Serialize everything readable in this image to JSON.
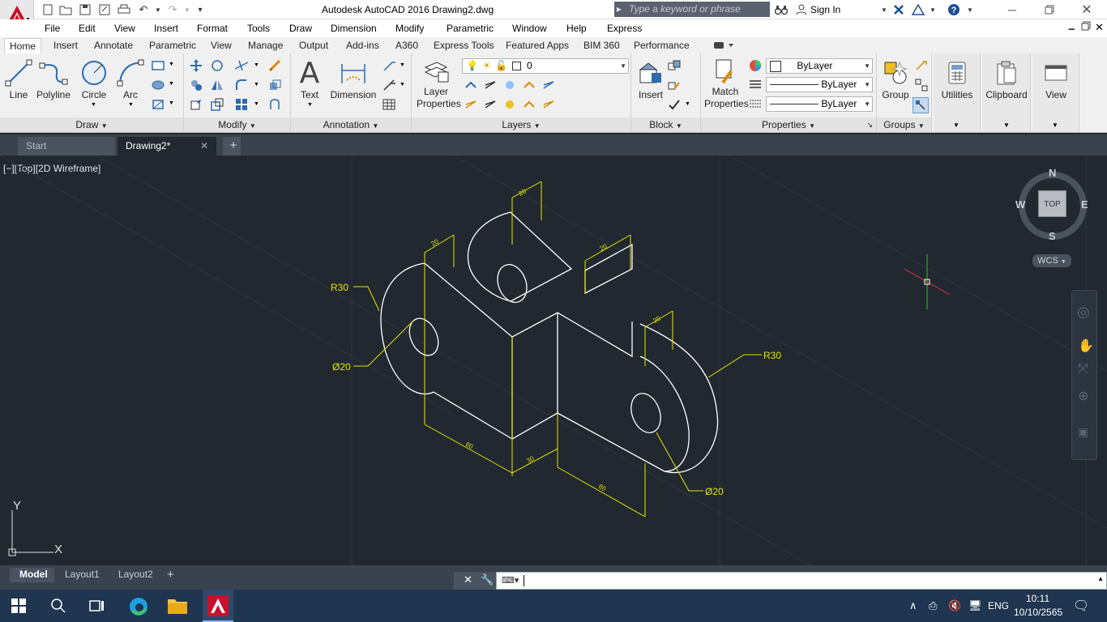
{
  "window": {
    "title": "Autodesk AutoCAD 2016   Drawing2.dwg",
    "app_logo": "A",
    "search_placeholder": "Type a keyword or phrase",
    "sign_in": "Sign In"
  },
  "menus": [
    "File",
    "Edit",
    "View",
    "Insert",
    "Format",
    "Tools",
    "Draw",
    "Dimension",
    "Modify",
    "Parametric",
    "Window",
    "Help",
    "Express"
  ],
  "ribbon_tabs": [
    "Home",
    "Insert",
    "Annotate",
    "Parametric",
    "View",
    "Manage",
    "Output",
    "Add-ins",
    "A360",
    "Express Tools",
    "Featured Apps",
    "BIM 360",
    "Performance"
  ],
  "ribbon": {
    "draw": {
      "title": "Draw",
      "line": "Line",
      "polyline": "Polyline",
      "circle": "Circle",
      "arc": "Arc"
    },
    "modify": {
      "title": "Modify"
    },
    "annotation": {
      "title": "Annotation",
      "text": "Text",
      "dimension": "Dimension"
    },
    "layers": {
      "title": "Layers",
      "properties_1": "Layer",
      "properties_2": "Properties",
      "current_layer": "0"
    },
    "block": {
      "title": "Block",
      "insert": "Insert"
    },
    "properties": {
      "title": "Properties",
      "match_1": "Match",
      "match_2": "Properties",
      "color": "ByLayer",
      "linetype": "ByLayer",
      "lineweight": "ByLayer"
    },
    "groups": {
      "title": "Groups",
      "group": "Group"
    },
    "utilities": "Utilities",
    "clipboard": "Clipboard",
    "view": "View"
  },
  "doc_tabs": {
    "start": "Start",
    "drawing": "Drawing2*"
  },
  "viewport": {
    "label": "[−][Top][2D Wireframe]",
    "compass": {
      "n": "N",
      "s": "S",
      "e": "E",
      "w": "W",
      "top": "TOP",
      "wcs": "WCS"
    },
    "ucs": {
      "x": "X",
      "y": "Y"
    }
  },
  "drawing_annotations": {
    "r30_left": "R30",
    "r30_right": "R30",
    "dia20_left": "Ø20",
    "dia20_right": "Ø20",
    "dim_top": "20",
    "dim_left_top": "20",
    "dim_right_top": "20",
    "dim_right_mid": "20",
    "dim_bottom_left": "60",
    "dim_bottom_mid": "30",
    "dim_bottom_right": "60"
  },
  "layout_tabs": [
    "Model",
    "Layout1",
    "Layout2"
  ],
  "taskbar": {
    "lang": "ENG",
    "time": "10:11",
    "date": "10/10/2565"
  },
  "colors": {
    "canvas": "#212830",
    "accent": "#c8102e",
    "dimension": "#e6e600",
    "geometry": "#ffffff"
  }
}
